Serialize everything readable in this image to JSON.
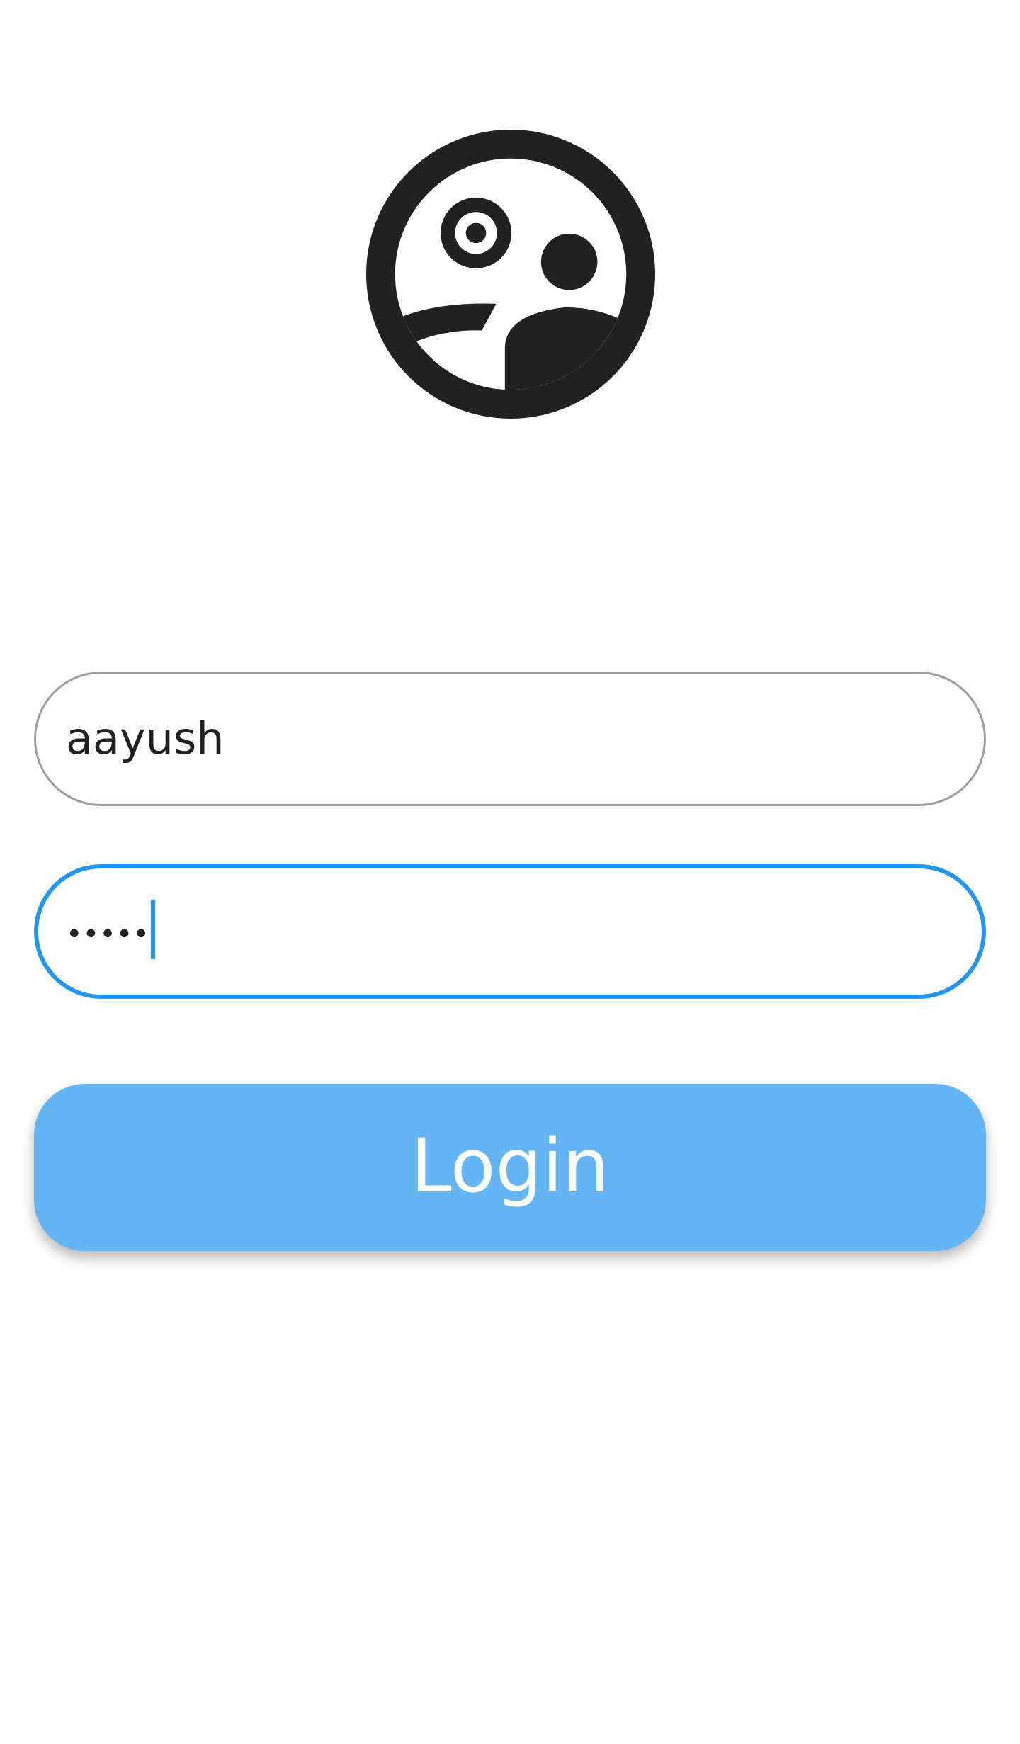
{
  "login_form": {
    "logo_icon": "face-logo-icon",
    "username": {
      "value": "aayush"
    },
    "password": {
      "masked_value": "•••••"
    },
    "login_button_label": "Login"
  },
  "colors": {
    "accent": "#2196f3",
    "button": "#64b5f6",
    "text": "#212121",
    "border_idle": "#9e9e9e",
    "logo": "#212121"
  }
}
